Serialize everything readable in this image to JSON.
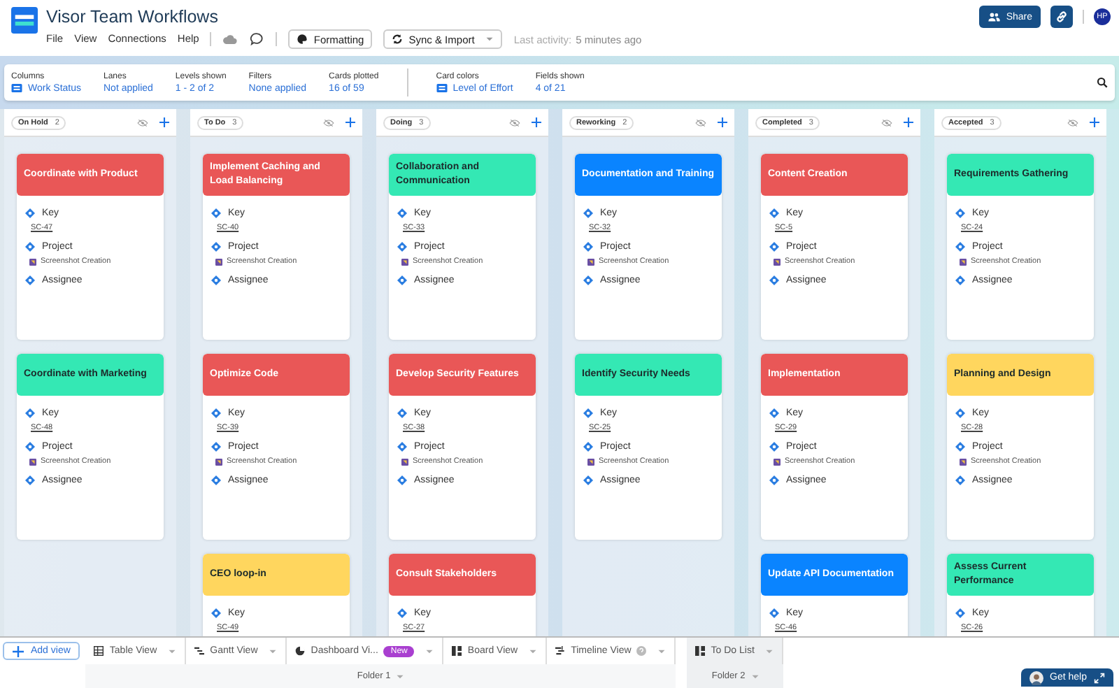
{
  "window": {
    "title": "Visor Team Workflows"
  },
  "menu": [
    "File",
    "View",
    "Connections",
    "Help"
  ],
  "toolbar": {
    "formatting": "Formatting",
    "sync": "Sync & Import",
    "last_activity_label": "Last activity:",
    "last_activity": "5 minutes ago"
  },
  "header_actions": {
    "share": "Share",
    "avatar": "HP"
  },
  "settings": [
    {
      "label": "Columns",
      "value": "Work Status",
      "icon": true
    },
    {
      "label": "Lanes",
      "value": "Not applied",
      "icon": false
    },
    {
      "label": "Levels shown",
      "value": "1 - 2 of 2",
      "icon": false
    },
    {
      "label": "Filters",
      "value": "None applied",
      "icon": false
    },
    {
      "label": "Cards plotted",
      "value": "16 of 59",
      "icon": false
    },
    {
      "label": "Card colors",
      "value": "Level of Effort",
      "icon": true
    },
    {
      "label": "Fields shown",
      "value": "4 of 21",
      "icon": false
    }
  ],
  "columns": [
    {
      "name": "On Hold",
      "count": "2",
      "cards": [
        {
          "title": "Coordinate with Product",
          "color": "#e95757",
          "fields": [
            {
              "label": "Key",
              "value": "SC-47",
              "kind": "link"
            },
            {
              "label": "Project",
              "value": "Screenshot Creation",
              "kind": "project"
            },
            {
              "label": "Assignee",
              "kind": "empty"
            }
          ]
        },
        {
          "title": "Coordinate with Marketing",
          "color": "#34e8b4",
          "fields": [
            {
              "label": "Key",
              "value": "SC-48",
              "kind": "link"
            },
            {
              "label": "Project",
              "value": "Screenshot Creation",
              "kind": "project"
            },
            {
              "label": "Assignee",
              "kind": "empty"
            }
          ]
        }
      ]
    },
    {
      "name": "To Do",
      "count": "3",
      "cards": [
        {
          "title": "Implement Caching and Load Balancing",
          "color": "#e95757",
          "fields": [
            {
              "label": "Key",
              "value": "SC-40",
              "kind": "link"
            },
            {
              "label": "Project",
              "value": "Screenshot Creation",
              "kind": "project"
            },
            {
              "label": "Assignee",
              "kind": "empty"
            }
          ]
        },
        {
          "title": "Optimize Code",
          "color": "#e95757",
          "fields": [
            {
              "label": "Key",
              "value": "SC-39",
              "kind": "link"
            },
            {
              "label": "Project",
              "value": "Screenshot Creation",
              "kind": "project"
            },
            {
              "label": "Assignee",
              "kind": "empty"
            }
          ]
        },
        {
          "title": "CEO loop-in",
          "color": "#ffd65e",
          "fields": [
            {
              "label": "Key",
              "value": "SC-49",
              "kind": "link"
            }
          ]
        }
      ]
    },
    {
      "name": "Doing",
      "count": "3",
      "cards": [
        {
          "title": "Collaboration and Communication",
          "color": "#34e8b4",
          "fields": [
            {
              "label": "Key",
              "value": "SC-33",
              "kind": "link"
            },
            {
              "label": "Project",
              "value": "Screenshot Creation",
              "kind": "project"
            },
            {
              "label": "Assignee",
              "kind": "empty"
            }
          ]
        },
        {
          "title": "Develop Security Features",
          "color": "#e95757",
          "fields": [
            {
              "label": "Key",
              "value": "SC-38",
              "kind": "link"
            },
            {
              "label": "Project",
              "value": "Screenshot Creation",
              "kind": "project"
            },
            {
              "label": "Assignee",
              "kind": "empty"
            }
          ]
        },
        {
          "title": "Consult Stakeholders",
          "color": "#e95757",
          "fields": [
            {
              "label": "Key",
              "value": "SC-27",
              "kind": "link"
            }
          ]
        }
      ]
    },
    {
      "name": "Reworking",
      "count": "2",
      "cards": [
        {
          "title": "Documentation and Training",
          "color": "#0a84ff",
          "fields": [
            {
              "label": "Key",
              "value": "SC-32",
              "kind": "link"
            },
            {
              "label": "Project",
              "value": "Screenshot Creation",
              "kind": "project"
            },
            {
              "label": "Assignee",
              "kind": "empty"
            }
          ]
        },
        {
          "title": "Identify Security Needs",
          "color": "#34e8b4",
          "fields": [
            {
              "label": "Key",
              "value": "SC-25",
              "kind": "link"
            },
            {
              "label": "Project",
              "value": "Screenshot Creation",
              "kind": "project"
            },
            {
              "label": "Assignee",
              "kind": "empty"
            }
          ]
        }
      ]
    },
    {
      "name": "Completed",
      "count": "3",
      "cards": [
        {
          "title": "Content Creation",
          "color": "#e95757",
          "fields": [
            {
              "label": "Key",
              "value": "SC-5",
              "kind": "link"
            },
            {
              "label": "Project",
              "value": "Screenshot Creation",
              "kind": "project"
            },
            {
              "label": "Assignee",
              "kind": "empty"
            }
          ]
        },
        {
          "title": "Implementation",
          "color": "#e95757",
          "fields": [
            {
              "label": "Key",
              "value": "SC-29",
              "kind": "link"
            },
            {
              "label": "Project",
              "value": "Screenshot Creation",
              "kind": "project"
            },
            {
              "label": "Assignee",
              "kind": "empty"
            }
          ]
        },
        {
          "title": "Update API Documentation",
          "color": "#0a84ff",
          "fields": [
            {
              "label": "Key",
              "value": "SC-46",
              "kind": "link"
            }
          ]
        }
      ]
    },
    {
      "name": "Accepted",
      "count": "3",
      "cards": [
        {
          "title": "Requirements Gathering",
          "color": "#34e8b4",
          "fields": [
            {
              "label": "Key",
              "value": "SC-24",
              "kind": "link"
            },
            {
              "label": "Project",
              "value": "Screenshot Creation",
              "kind": "project"
            },
            {
              "label": "Assignee",
              "kind": "empty"
            }
          ]
        },
        {
          "title": "Planning and Design",
          "color": "#ffd65e",
          "fields": [
            {
              "label": "Key",
              "value": "SC-28",
              "kind": "link"
            },
            {
              "label": "Project",
              "value": "Screenshot Creation",
              "kind": "project"
            },
            {
              "label": "Assignee",
              "kind": "empty"
            }
          ]
        },
        {
          "title": "Assess Current Performance",
          "color": "#34e8b4",
          "fields": [
            {
              "label": "Key",
              "value": "SC-26",
              "kind": "link"
            }
          ]
        }
      ]
    }
  ],
  "add_view": "Add view",
  "folders": [
    {
      "name": "Folder 1",
      "views": [
        {
          "label": "Table View",
          "kind": "table",
          "selected": false
        },
        {
          "label": "Gantt View",
          "kind": "gantt",
          "selected": false
        },
        {
          "label": "Dashboard Vi...",
          "kind": "dashboard",
          "badge": "New",
          "selected": false
        },
        {
          "label": "Board View",
          "kind": "board",
          "selected": false
        },
        {
          "label": "Timeline View",
          "kind": "timeline",
          "help": true,
          "selected": false
        }
      ]
    },
    {
      "name": "Folder 2",
      "views": [
        {
          "label": "To Do List",
          "kind": "board",
          "selected": true
        }
      ]
    }
  ],
  "help_button": "Get help"
}
